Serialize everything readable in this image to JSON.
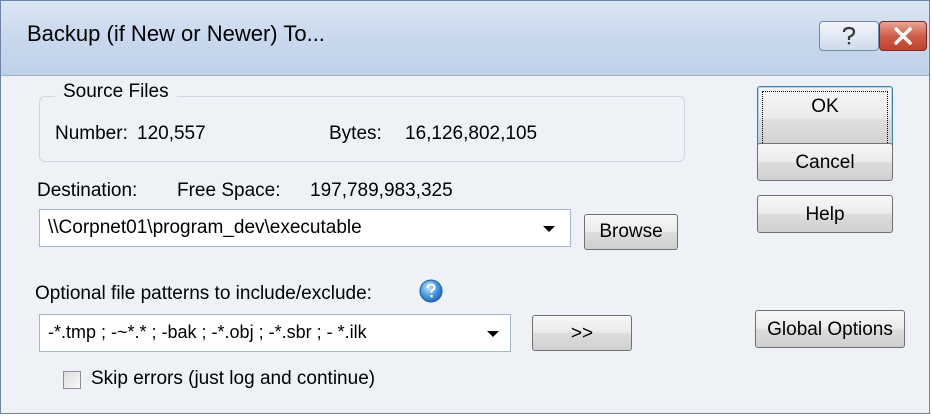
{
  "window": {
    "title": "Backup (if New or Newer) To...",
    "titlebar_buttons": [
      "help-icon",
      "close-icon"
    ]
  },
  "source_files": {
    "legend": "Source Files",
    "number_label": "Number:",
    "number_value": "120,557",
    "bytes_label": "Bytes:",
    "bytes_value": "16,126,802,105"
  },
  "destination": {
    "label": "Destination:",
    "free_space_label": "Free Space:",
    "free_space_value": "197,789,983,325",
    "path_value": "\\\\Corpnet01\\program_dev\\executable",
    "browse_label": "Browse"
  },
  "patterns": {
    "label": "Optional file patterns to include/exclude:",
    "info_icon": "info-icon",
    "value": "-*.tmp ; -~*.* ; -bak ; -*.obj ; -*.sbr ; - *.ilk",
    "expand_label": ">>"
  },
  "skip_errors": {
    "label": "Skip errors (just log and continue)",
    "checked": false
  },
  "buttons": {
    "ok": "OK",
    "cancel": "Cancel",
    "help": "Help",
    "global_options": "Global Options"
  },
  "colors": {
    "titlebar": "#cad9ed",
    "body": "#eef1f6",
    "close_button": "#c2412b",
    "default_button_border": "#3c7fb1"
  }
}
